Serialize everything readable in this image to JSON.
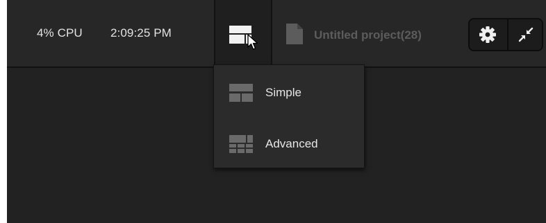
{
  "status": {
    "cpu": "4% CPU",
    "clock": "2:09:25 PM"
  },
  "project": {
    "name": "Untitled project(28)",
    "icon": "document-icon"
  },
  "toolbar": {
    "layout_icon": "layout-icon",
    "settings_icon": "gear-icon",
    "compress_icon": "compress-icon"
  },
  "layout_menu": {
    "items": [
      {
        "label": "Simple",
        "icon": "simple-layout-icon"
      },
      {
        "label": "Advanced",
        "icon": "advanced-layout-icon"
      }
    ]
  },
  "colors": {
    "background": "#222222",
    "topbar": "#272727",
    "text": "#e3e3e3",
    "muted": "#5c5c5c"
  }
}
